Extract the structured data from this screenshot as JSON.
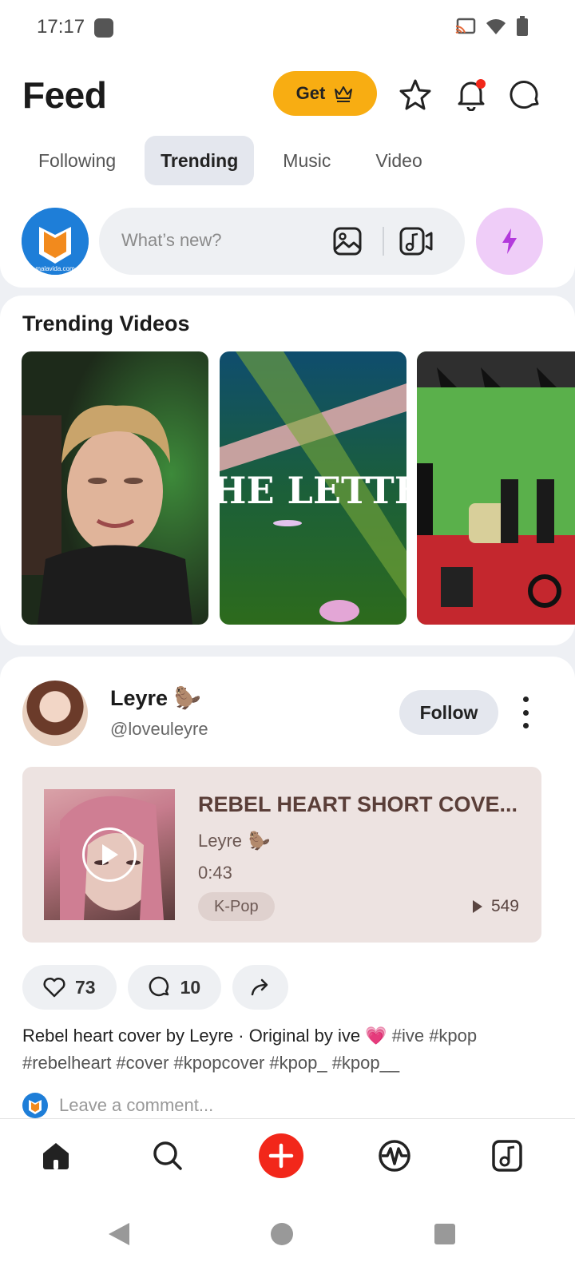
{
  "status_bar": {
    "time": "17:17"
  },
  "header": {
    "title": "Feed",
    "get_label": "Get",
    "tabs": [
      {
        "label": "Following",
        "active": false
      },
      {
        "label": "Trending",
        "active": true
      },
      {
        "label": "Music",
        "active": false
      },
      {
        "label": "Video",
        "active": false
      }
    ],
    "compose_placeholder": "What’s new?",
    "avatar_text": "malavida.com"
  },
  "trending": {
    "title": "Trending Videos",
    "video_2_text": "HE LETTE"
  },
  "post": {
    "author_name": "Leyre",
    "author_handle": "@loveuleyre",
    "follow_label": "Follow",
    "track": {
      "title": "REBEL HEART SHORT COVE...",
      "artist": "Leyre",
      "duration": "0:43",
      "genre": "K-Pop",
      "plays": "549"
    },
    "likes": "73",
    "comments": "10",
    "caption": "Rebel heart cover by Leyre · Original by ive 💗",
    "hashtags": "#ive #kpop #rebelheart #cover #kpopcover #kpop_ #kpop__",
    "comment_placeholder": "Leave a comment..."
  },
  "colors": {
    "accent_yellow": "#f8ad12",
    "accent_red": "#f2271a",
    "bolt_purple": "#b33adc",
    "track_bg": "#ede3e1"
  }
}
